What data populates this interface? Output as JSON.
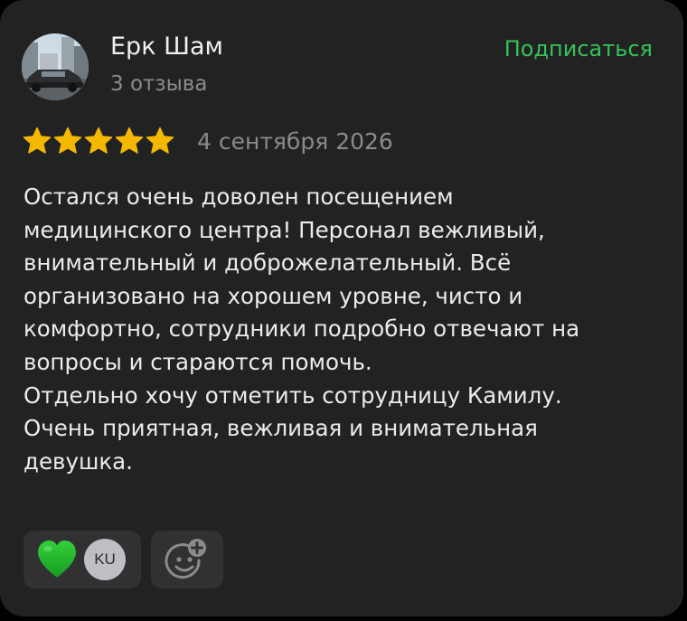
{
  "author": {
    "name": "Ерк Шам",
    "review_count": "3 отзыва",
    "avatar": "car-photo-avatar"
  },
  "subscribe_label": "Подписаться",
  "rating": {
    "stars": 5,
    "max": 5,
    "color": "#f5b800"
  },
  "date": "4 сентября 2026",
  "review_lines": [
    "Остался очень доволен посещением",
    "медицинского центра! Персонал вежливый,",
    "внимательный и доброжелательный. Всё",
    "организовано на хорошем уровне, чисто и",
    "комфортно, сотрудники подробно отвечают на",
    "вопросы и стараются помочь.",
    "Отдельно хочу отметить сотрудницу Камилу.",
    "Очень приятная, вежливая и внимательная",
    "девушка."
  ],
  "reactions": {
    "emoji": "green-heart-icon",
    "user_initials": "KU",
    "add_icon": "add-reaction-smile-icon"
  },
  "colors": {
    "background": "#222223",
    "accent_green": "#35c25a",
    "secondary_text": "#8b8b8e",
    "star": "#f5b800",
    "heart": "#22b02a"
  }
}
